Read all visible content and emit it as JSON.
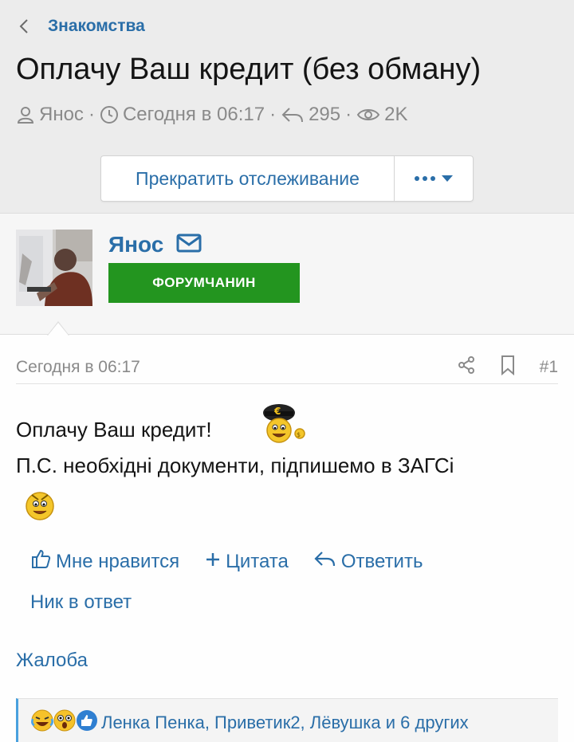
{
  "breadcrumb": {
    "label": "Знакомства"
  },
  "thread": {
    "title": "Оплачу Ваш кредит (без обману)",
    "author": "Янос",
    "date": "Сегодня в 06:17",
    "replies": "295",
    "views": "2K"
  },
  "toolbar": {
    "watch_label": "Прекратить отслеживание"
  },
  "user": {
    "name": "Янос",
    "role": "ФОРУМЧАНИН"
  },
  "post": {
    "date": "Сегодня в 06:17",
    "number": "#1",
    "line1": "Оплачу Ваш кредит!",
    "line2": "П.С. необхідні документи, підпишемо в ЗАГСі"
  },
  "actions": {
    "like": "Мне нравится",
    "quote": "Цитата",
    "reply": "Ответить",
    "nick": "Ник в ответ",
    "report": "Жалоба"
  },
  "reactions": {
    "text": "Ленка Пенка, Приветик2, Лёвушка и 6 других"
  },
  "colors": {
    "accent": "#2a6ea8",
    "role_badge": "#23951f",
    "reaction_border": "#49a1de"
  }
}
